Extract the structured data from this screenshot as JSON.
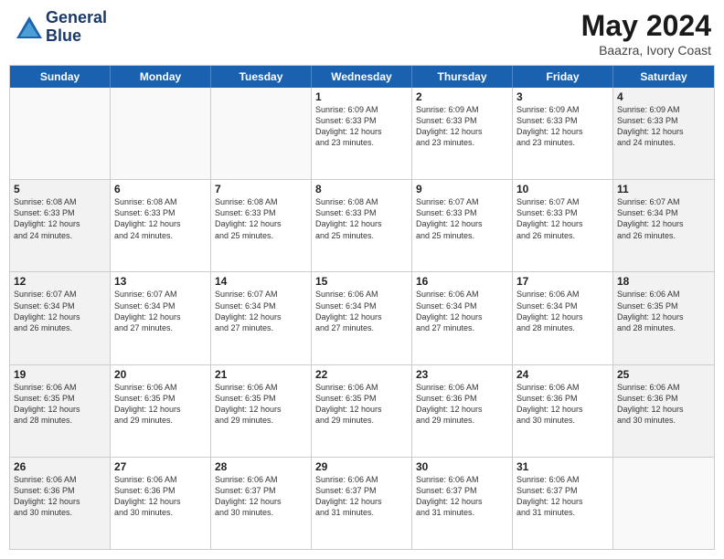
{
  "logo": {
    "line1": "General",
    "line2": "Blue"
  },
  "title": "May 2024",
  "location": "Baazra, Ivory Coast",
  "dayHeaders": [
    "Sunday",
    "Monday",
    "Tuesday",
    "Wednesday",
    "Thursday",
    "Friday",
    "Saturday"
  ],
  "rows": [
    [
      {
        "day": "",
        "info": "",
        "empty": true
      },
      {
        "day": "",
        "info": "",
        "empty": true
      },
      {
        "day": "",
        "info": "",
        "empty": true
      },
      {
        "day": "1",
        "info": "Sunrise: 6:09 AM\nSunset: 6:33 PM\nDaylight: 12 hours\nand 23 minutes.",
        "shaded": false
      },
      {
        "day": "2",
        "info": "Sunrise: 6:09 AM\nSunset: 6:33 PM\nDaylight: 12 hours\nand 23 minutes.",
        "shaded": false
      },
      {
        "day": "3",
        "info": "Sunrise: 6:09 AM\nSunset: 6:33 PM\nDaylight: 12 hours\nand 23 minutes.",
        "shaded": false
      },
      {
        "day": "4",
        "info": "Sunrise: 6:09 AM\nSunset: 6:33 PM\nDaylight: 12 hours\nand 24 minutes.",
        "shaded": true
      }
    ],
    [
      {
        "day": "5",
        "info": "Sunrise: 6:08 AM\nSunset: 6:33 PM\nDaylight: 12 hours\nand 24 minutes.",
        "shaded": true
      },
      {
        "day": "6",
        "info": "Sunrise: 6:08 AM\nSunset: 6:33 PM\nDaylight: 12 hours\nand 24 minutes.",
        "shaded": false
      },
      {
        "day": "7",
        "info": "Sunrise: 6:08 AM\nSunset: 6:33 PM\nDaylight: 12 hours\nand 25 minutes.",
        "shaded": false
      },
      {
        "day": "8",
        "info": "Sunrise: 6:08 AM\nSunset: 6:33 PM\nDaylight: 12 hours\nand 25 minutes.",
        "shaded": false
      },
      {
        "day": "9",
        "info": "Sunrise: 6:07 AM\nSunset: 6:33 PM\nDaylight: 12 hours\nand 25 minutes.",
        "shaded": false
      },
      {
        "day": "10",
        "info": "Sunrise: 6:07 AM\nSunset: 6:33 PM\nDaylight: 12 hours\nand 26 minutes.",
        "shaded": false
      },
      {
        "day": "11",
        "info": "Sunrise: 6:07 AM\nSunset: 6:34 PM\nDaylight: 12 hours\nand 26 minutes.",
        "shaded": true
      }
    ],
    [
      {
        "day": "12",
        "info": "Sunrise: 6:07 AM\nSunset: 6:34 PM\nDaylight: 12 hours\nand 26 minutes.",
        "shaded": true
      },
      {
        "day": "13",
        "info": "Sunrise: 6:07 AM\nSunset: 6:34 PM\nDaylight: 12 hours\nand 27 minutes.",
        "shaded": false
      },
      {
        "day": "14",
        "info": "Sunrise: 6:07 AM\nSunset: 6:34 PM\nDaylight: 12 hours\nand 27 minutes.",
        "shaded": false
      },
      {
        "day": "15",
        "info": "Sunrise: 6:06 AM\nSunset: 6:34 PM\nDaylight: 12 hours\nand 27 minutes.",
        "shaded": false
      },
      {
        "day": "16",
        "info": "Sunrise: 6:06 AM\nSunset: 6:34 PM\nDaylight: 12 hours\nand 27 minutes.",
        "shaded": false
      },
      {
        "day": "17",
        "info": "Sunrise: 6:06 AM\nSunset: 6:34 PM\nDaylight: 12 hours\nand 28 minutes.",
        "shaded": false
      },
      {
        "day": "18",
        "info": "Sunrise: 6:06 AM\nSunset: 6:35 PM\nDaylight: 12 hours\nand 28 minutes.",
        "shaded": true
      }
    ],
    [
      {
        "day": "19",
        "info": "Sunrise: 6:06 AM\nSunset: 6:35 PM\nDaylight: 12 hours\nand 28 minutes.",
        "shaded": true
      },
      {
        "day": "20",
        "info": "Sunrise: 6:06 AM\nSunset: 6:35 PM\nDaylight: 12 hours\nand 29 minutes.",
        "shaded": false
      },
      {
        "day": "21",
        "info": "Sunrise: 6:06 AM\nSunset: 6:35 PM\nDaylight: 12 hours\nand 29 minutes.",
        "shaded": false
      },
      {
        "day": "22",
        "info": "Sunrise: 6:06 AM\nSunset: 6:35 PM\nDaylight: 12 hours\nand 29 minutes.",
        "shaded": false
      },
      {
        "day": "23",
        "info": "Sunrise: 6:06 AM\nSunset: 6:36 PM\nDaylight: 12 hours\nand 29 minutes.",
        "shaded": false
      },
      {
        "day": "24",
        "info": "Sunrise: 6:06 AM\nSunset: 6:36 PM\nDaylight: 12 hours\nand 30 minutes.",
        "shaded": false
      },
      {
        "day": "25",
        "info": "Sunrise: 6:06 AM\nSunset: 6:36 PM\nDaylight: 12 hours\nand 30 minutes.",
        "shaded": true
      }
    ],
    [
      {
        "day": "26",
        "info": "Sunrise: 6:06 AM\nSunset: 6:36 PM\nDaylight: 12 hours\nand 30 minutes.",
        "shaded": true
      },
      {
        "day": "27",
        "info": "Sunrise: 6:06 AM\nSunset: 6:36 PM\nDaylight: 12 hours\nand 30 minutes.",
        "shaded": false
      },
      {
        "day": "28",
        "info": "Sunrise: 6:06 AM\nSunset: 6:37 PM\nDaylight: 12 hours\nand 30 minutes.",
        "shaded": false
      },
      {
        "day": "29",
        "info": "Sunrise: 6:06 AM\nSunset: 6:37 PM\nDaylight: 12 hours\nand 31 minutes.",
        "shaded": false
      },
      {
        "day": "30",
        "info": "Sunrise: 6:06 AM\nSunset: 6:37 PM\nDaylight: 12 hours\nand 31 minutes.",
        "shaded": false
      },
      {
        "day": "31",
        "info": "Sunrise: 6:06 AM\nSunset: 6:37 PM\nDaylight: 12 hours\nand 31 minutes.",
        "shaded": false
      },
      {
        "day": "",
        "info": "",
        "empty": true
      }
    ]
  ]
}
